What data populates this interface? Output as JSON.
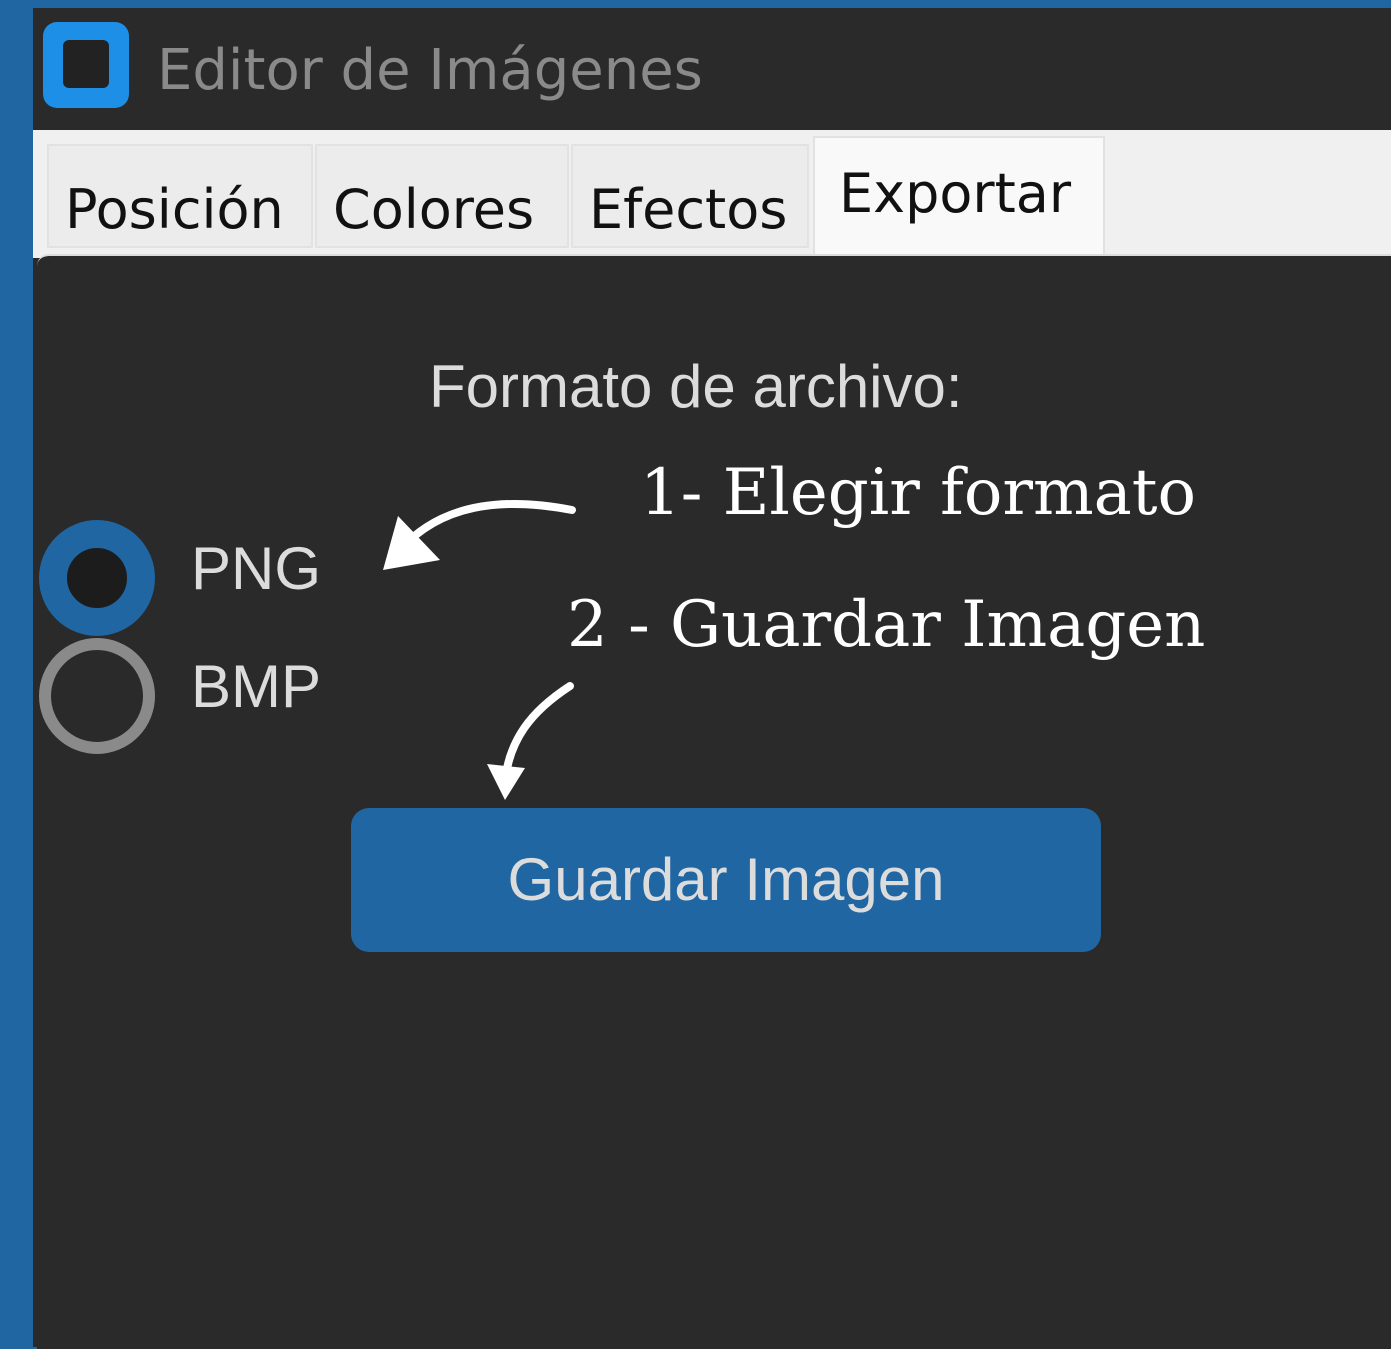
{
  "window": {
    "title": "Editor de Imágenes"
  },
  "tabs": [
    {
      "label": "Posición",
      "active": false
    },
    {
      "label": "Colores",
      "active": false
    },
    {
      "label": "Efectos",
      "active": false
    },
    {
      "label": "Exportar",
      "active": true
    }
  ],
  "export": {
    "format_label": "Formato de archivo:",
    "options": [
      {
        "label": "PNG",
        "selected": true
      },
      {
        "label": "BMP",
        "selected": false
      }
    ],
    "save_button_label": "Guardar Imagen"
  },
  "annotations": {
    "step1": "1- Elegir formato",
    "step2": "2 - Guardar Imagen"
  },
  "colors": {
    "accent": "#1f66a3",
    "window_bg": "#2a2a2a",
    "tabbar_bg": "#f0f0f0",
    "app_icon": "#1e8fe6"
  },
  "icons": {
    "app": "app-icon",
    "arrow": "curved-arrow"
  }
}
